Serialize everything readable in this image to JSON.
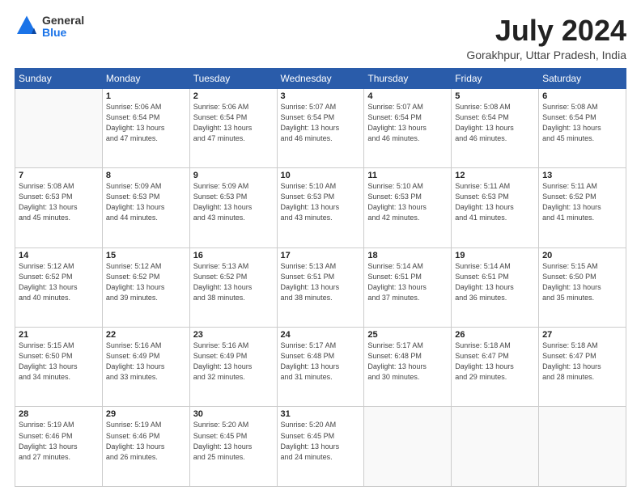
{
  "header": {
    "logo_general": "General",
    "logo_blue": "Blue",
    "month_title": "July 2024",
    "subtitle": "Gorakhpur, Uttar Pradesh, India"
  },
  "days_of_week": [
    "Sunday",
    "Monday",
    "Tuesday",
    "Wednesday",
    "Thursday",
    "Friday",
    "Saturday"
  ],
  "weeks": [
    [
      {
        "day": null
      },
      {
        "day": "1",
        "sunrise": "Sunrise: 5:06 AM",
        "sunset": "Sunset: 6:54 PM",
        "daylight": "Daylight: 13 hours and 47 minutes."
      },
      {
        "day": "2",
        "sunrise": "Sunrise: 5:06 AM",
        "sunset": "Sunset: 6:54 PM",
        "daylight": "Daylight: 13 hours and 47 minutes."
      },
      {
        "day": "3",
        "sunrise": "Sunrise: 5:07 AM",
        "sunset": "Sunset: 6:54 PM",
        "daylight": "Daylight: 13 hours and 46 minutes."
      },
      {
        "day": "4",
        "sunrise": "Sunrise: 5:07 AM",
        "sunset": "Sunset: 6:54 PM",
        "daylight": "Daylight: 13 hours and 46 minutes."
      },
      {
        "day": "5",
        "sunrise": "Sunrise: 5:08 AM",
        "sunset": "Sunset: 6:54 PM",
        "daylight": "Daylight: 13 hours and 46 minutes."
      },
      {
        "day": "6",
        "sunrise": "Sunrise: 5:08 AM",
        "sunset": "Sunset: 6:54 PM",
        "daylight": "Daylight: 13 hours and 45 minutes."
      }
    ],
    [
      {
        "day": "7",
        "sunrise": "Sunrise: 5:08 AM",
        "sunset": "Sunset: 6:53 PM",
        "daylight": "Daylight: 13 hours and 45 minutes."
      },
      {
        "day": "8",
        "sunrise": "Sunrise: 5:09 AM",
        "sunset": "Sunset: 6:53 PM",
        "daylight": "Daylight: 13 hours and 44 minutes."
      },
      {
        "day": "9",
        "sunrise": "Sunrise: 5:09 AM",
        "sunset": "Sunset: 6:53 PM",
        "daylight": "Daylight: 13 hours and 43 minutes."
      },
      {
        "day": "10",
        "sunrise": "Sunrise: 5:10 AM",
        "sunset": "Sunset: 6:53 PM",
        "daylight": "Daylight: 13 hours and 43 minutes."
      },
      {
        "day": "11",
        "sunrise": "Sunrise: 5:10 AM",
        "sunset": "Sunset: 6:53 PM",
        "daylight": "Daylight: 13 hours and 42 minutes."
      },
      {
        "day": "12",
        "sunrise": "Sunrise: 5:11 AM",
        "sunset": "Sunset: 6:53 PM",
        "daylight": "Daylight: 13 hours and 41 minutes."
      },
      {
        "day": "13",
        "sunrise": "Sunrise: 5:11 AM",
        "sunset": "Sunset: 6:52 PM",
        "daylight": "Daylight: 13 hours and 41 minutes."
      }
    ],
    [
      {
        "day": "14",
        "sunrise": "Sunrise: 5:12 AM",
        "sunset": "Sunset: 6:52 PM",
        "daylight": "Daylight: 13 hours and 40 minutes."
      },
      {
        "day": "15",
        "sunrise": "Sunrise: 5:12 AM",
        "sunset": "Sunset: 6:52 PM",
        "daylight": "Daylight: 13 hours and 39 minutes."
      },
      {
        "day": "16",
        "sunrise": "Sunrise: 5:13 AM",
        "sunset": "Sunset: 6:52 PM",
        "daylight": "Daylight: 13 hours and 38 minutes."
      },
      {
        "day": "17",
        "sunrise": "Sunrise: 5:13 AM",
        "sunset": "Sunset: 6:51 PM",
        "daylight": "Daylight: 13 hours and 38 minutes."
      },
      {
        "day": "18",
        "sunrise": "Sunrise: 5:14 AM",
        "sunset": "Sunset: 6:51 PM",
        "daylight": "Daylight: 13 hours and 37 minutes."
      },
      {
        "day": "19",
        "sunrise": "Sunrise: 5:14 AM",
        "sunset": "Sunset: 6:51 PM",
        "daylight": "Daylight: 13 hours and 36 minutes."
      },
      {
        "day": "20",
        "sunrise": "Sunrise: 5:15 AM",
        "sunset": "Sunset: 6:50 PM",
        "daylight": "Daylight: 13 hours and 35 minutes."
      }
    ],
    [
      {
        "day": "21",
        "sunrise": "Sunrise: 5:15 AM",
        "sunset": "Sunset: 6:50 PM",
        "daylight": "Daylight: 13 hours and 34 minutes."
      },
      {
        "day": "22",
        "sunrise": "Sunrise: 5:16 AM",
        "sunset": "Sunset: 6:49 PM",
        "daylight": "Daylight: 13 hours and 33 minutes."
      },
      {
        "day": "23",
        "sunrise": "Sunrise: 5:16 AM",
        "sunset": "Sunset: 6:49 PM",
        "daylight": "Daylight: 13 hours and 32 minutes."
      },
      {
        "day": "24",
        "sunrise": "Sunrise: 5:17 AM",
        "sunset": "Sunset: 6:48 PM",
        "daylight": "Daylight: 13 hours and 31 minutes."
      },
      {
        "day": "25",
        "sunrise": "Sunrise: 5:17 AM",
        "sunset": "Sunset: 6:48 PM",
        "daylight": "Daylight: 13 hours and 30 minutes."
      },
      {
        "day": "26",
        "sunrise": "Sunrise: 5:18 AM",
        "sunset": "Sunset: 6:47 PM",
        "daylight": "Daylight: 13 hours and 29 minutes."
      },
      {
        "day": "27",
        "sunrise": "Sunrise: 5:18 AM",
        "sunset": "Sunset: 6:47 PM",
        "daylight": "Daylight: 13 hours and 28 minutes."
      }
    ],
    [
      {
        "day": "28",
        "sunrise": "Sunrise: 5:19 AM",
        "sunset": "Sunset: 6:46 PM",
        "daylight": "Daylight: 13 hours and 27 minutes."
      },
      {
        "day": "29",
        "sunrise": "Sunrise: 5:19 AM",
        "sunset": "Sunset: 6:46 PM",
        "daylight": "Daylight: 13 hours and 26 minutes."
      },
      {
        "day": "30",
        "sunrise": "Sunrise: 5:20 AM",
        "sunset": "Sunset: 6:45 PM",
        "daylight": "Daylight: 13 hours and 25 minutes."
      },
      {
        "day": "31",
        "sunrise": "Sunrise: 5:20 AM",
        "sunset": "Sunset: 6:45 PM",
        "daylight": "Daylight: 13 hours and 24 minutes."
      },
      {
        "day": null
      },
      {
        "day": null
      },
      {
        "day": null
      }
    ]
  ]
}
